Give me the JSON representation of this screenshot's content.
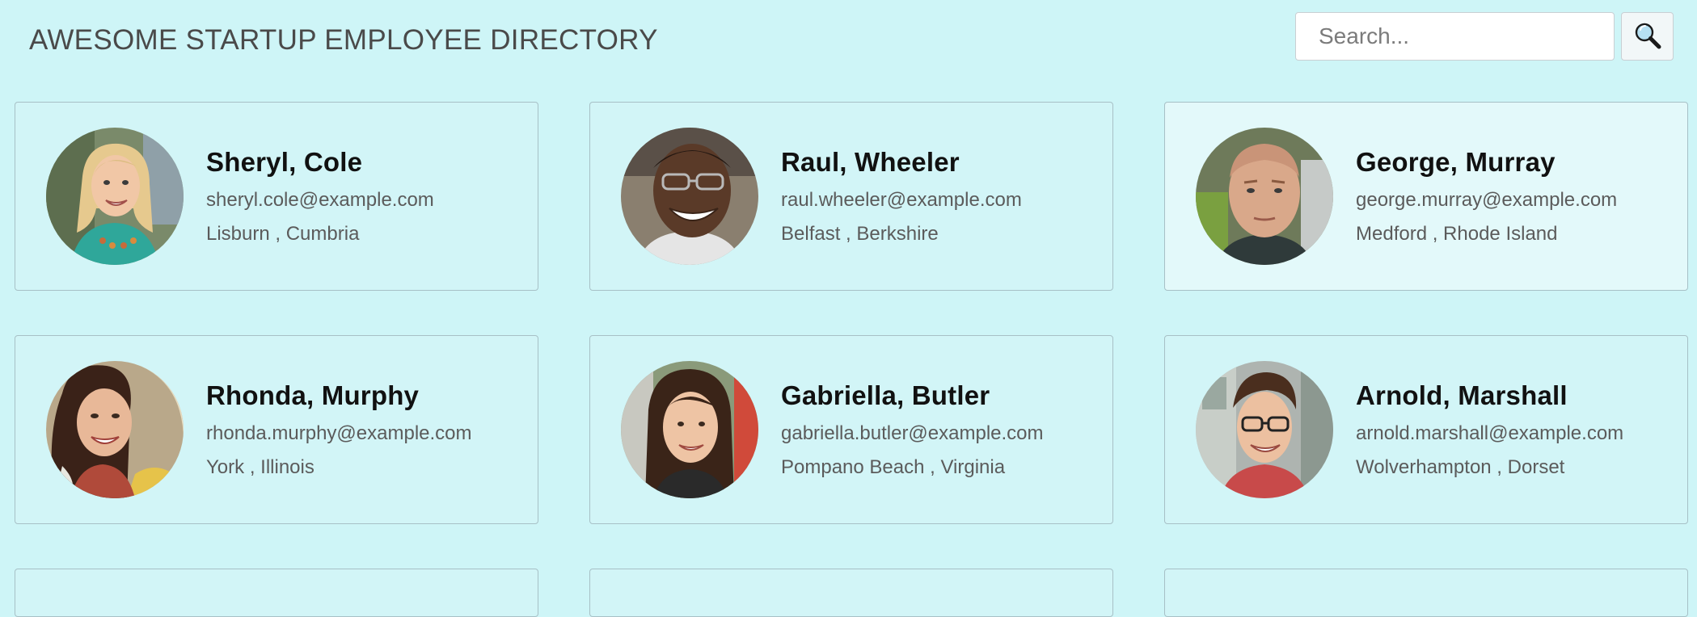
{
  "header": {
    "title": "AWESOME STARTUP EMPLOYEE DIRECTORY"
  },
  "search": {
    "placeholder": "Search...",
    "value": "",
    "button_icon": "search-icon"
  },
  "employees": [
    {
      "name": "Sheryl, Cole",
      "email": "sheryl.cole@example.com",
      "location": "Lisburn , Cumbria"
    },
    {
      "name": "Raul, Wheeler",
      "email": "raul.wheeler@example.com",
      "location": "Belfast , Berkshire"
    },
    {
      "name": "George, Murray",
      "email": "george.murray@example.com",
      "location": "Medford , Rhode Island"
    },
    {
      "name": "Rhonda, Murphy",
      "email": "rhonda.murphy@example.com",
      "location": "York , Illinois"
    },
    {
      "name": "Gabriella, Butler",
      "email": "gabriella.butler@example.com",
      "location": "Pompano Beach , Virginia"
    },
    {
      "name": "Arnold, Marshall",
      "email": "arnold.marshall@example.com",
      "location": "Wolverhampton , Dorset"
    }
  ],
  "colors": {
    "background": "#cef5f7",
    "card_border": "#a7c0c6",
    "title_text": "#4a4a4a",
    "name_text": "#111111",
    "detail_text": "#5b5b5b"
  }
}
